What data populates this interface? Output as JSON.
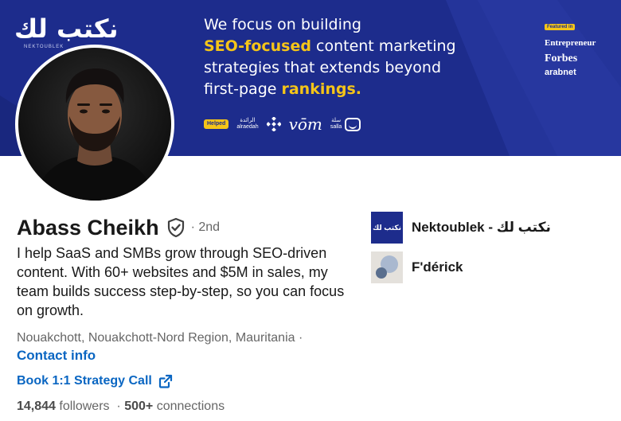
{
  "banner": {
    "brand_logo_text": "نكتب لك",
    "brand_sub": "NEKTOUBLEK",
    "headline_lines": [
      {
        "plain_before": "We focus on building",
        "accent": "",
        "plain_after": ""
      },
      {
        "plain_before": "",
        "accent": "SEO-focused",
        "plain_after": " content marketing"
      },
      {
        "plain_before": "strategies that extends beyond",
        "accent": "",
        "plain_after": ""
      },
      {
        "plain_before": "first-page ",
        "accent": "rankings.",
        "plain_after": ""
      }
    ],
    "helped_label": "Helped",
    "client_logos": [
      {
        "name": "alraedah",
        "text": "الرائدة\nalraedah"
      },
      {
        "name": "vom",
        "text": "vōm"
      },
      {
        "name": "salla",
        "text": "سلة\nsalla"
      }
    ],
    "featured_label": "Featured in",
    "publications": [
      "Entrepreneur",
      "Forbes",
      "arabnet"
    ],
    "colors": {
      "background": "#1d2c8c",
      "accent": "#f5c518"
    }
  },
  "profile": {
    "avatar_icon": "profile-photo",
    "name": "Abass Cheikh",
    "verified_icon": "verified-shield-icon",
    "degree": "· 2nd",
    "headline": "I help SaaS and SMBs grow through SEO-driven content. With 60+ websites and $5M in sales, my team builds success step-by-step, so you can focus on growth.",
    "location": "Nouakchott, Nouakchott-Nord Region, Mauritania ·",
    "contact_info": "Contact info",
    "website_link": "Book 1:1 Strategy Call",
    "followers_count": "14,844",
    "followers_label": "followers",
    "connections_count": "500+",
    "connections_label": "connections",
    "link_color": "#0a66c2"
  },
  "organizations": [
    {
      "name": "Nektoublek - نكتب لك",
      "logo_text": "نكتب لك"
    },
    {
      "name": "F'dérick",
      "logo_text": ""
    }
  ]
}
